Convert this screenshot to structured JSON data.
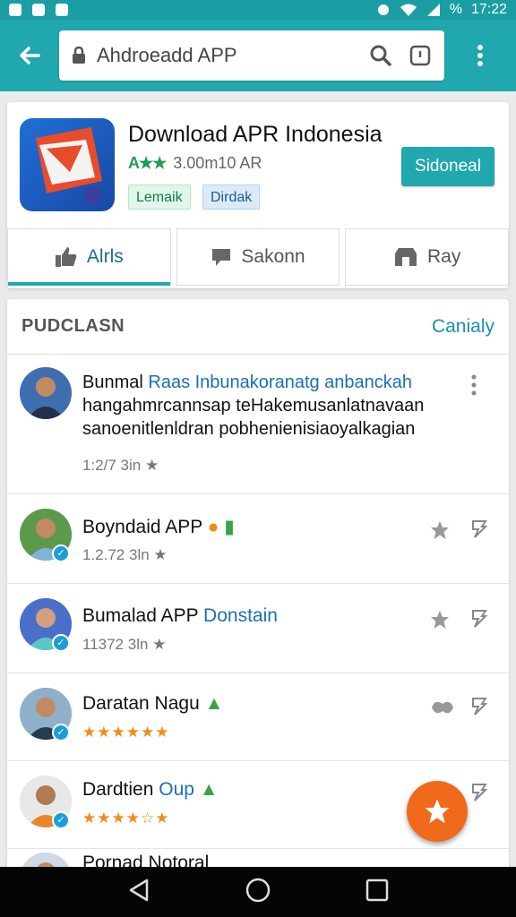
{
  "status_bar": {
    "time": "17:22",
    "battery": "%"
  },
  "toolbar": {
    "url_text": "Ahdroeadd APP"
  },
  "app": {
    "title": "Download APR Indonesia",
    "rating_stars": "A★★",
    "downloads": "3.00m10 AR",
    "chips": [
      "Lemaik",
      "Dirdak"
    ],
    "install_label": "Sidoneal"
  },
  "tabs": [
    {
      "label": "Alrls",
      "icon": "thumbs-up-icon"
    },
    {
      "label": "Sakonn",
      "icon": "comment-icon"
    },
    {
      "label": "Ray",
      "icon": "store-icon"
    }
  ],
  "list": {
    "header_title": "PUDCLASN",
    "header_link": "Canialy",
    "items": [
      {
        "title": "Bunmal",
        "title_blue": "Raas Inbunakoranatg anbanckah",
        "body": "hangahmrcannsap teHakemusanlatnavaan sanoenitlenldran pobhenienisiaoyalkagian",
        "meta": "1:2/7 3in ★"
      },
      {
        "title": "Boyndaid APP",
        "meta": "1.2.72 3ln ★"
      },
      {
        "title": "Bumalad APP",
        "title_blue": "Donstain",
        "meta": "11372 3ln ★"
      },
      {
        "title": "Daratan Nagu",
        "stars": "★★★★★★"
      },
      {
        "title": "Dardtien",
        "title_blue": "Oup",
        "stars": "★★★★☆★"
      },
      {
        "title": "Pornad Notoral"
      }
    ]
  }
}
